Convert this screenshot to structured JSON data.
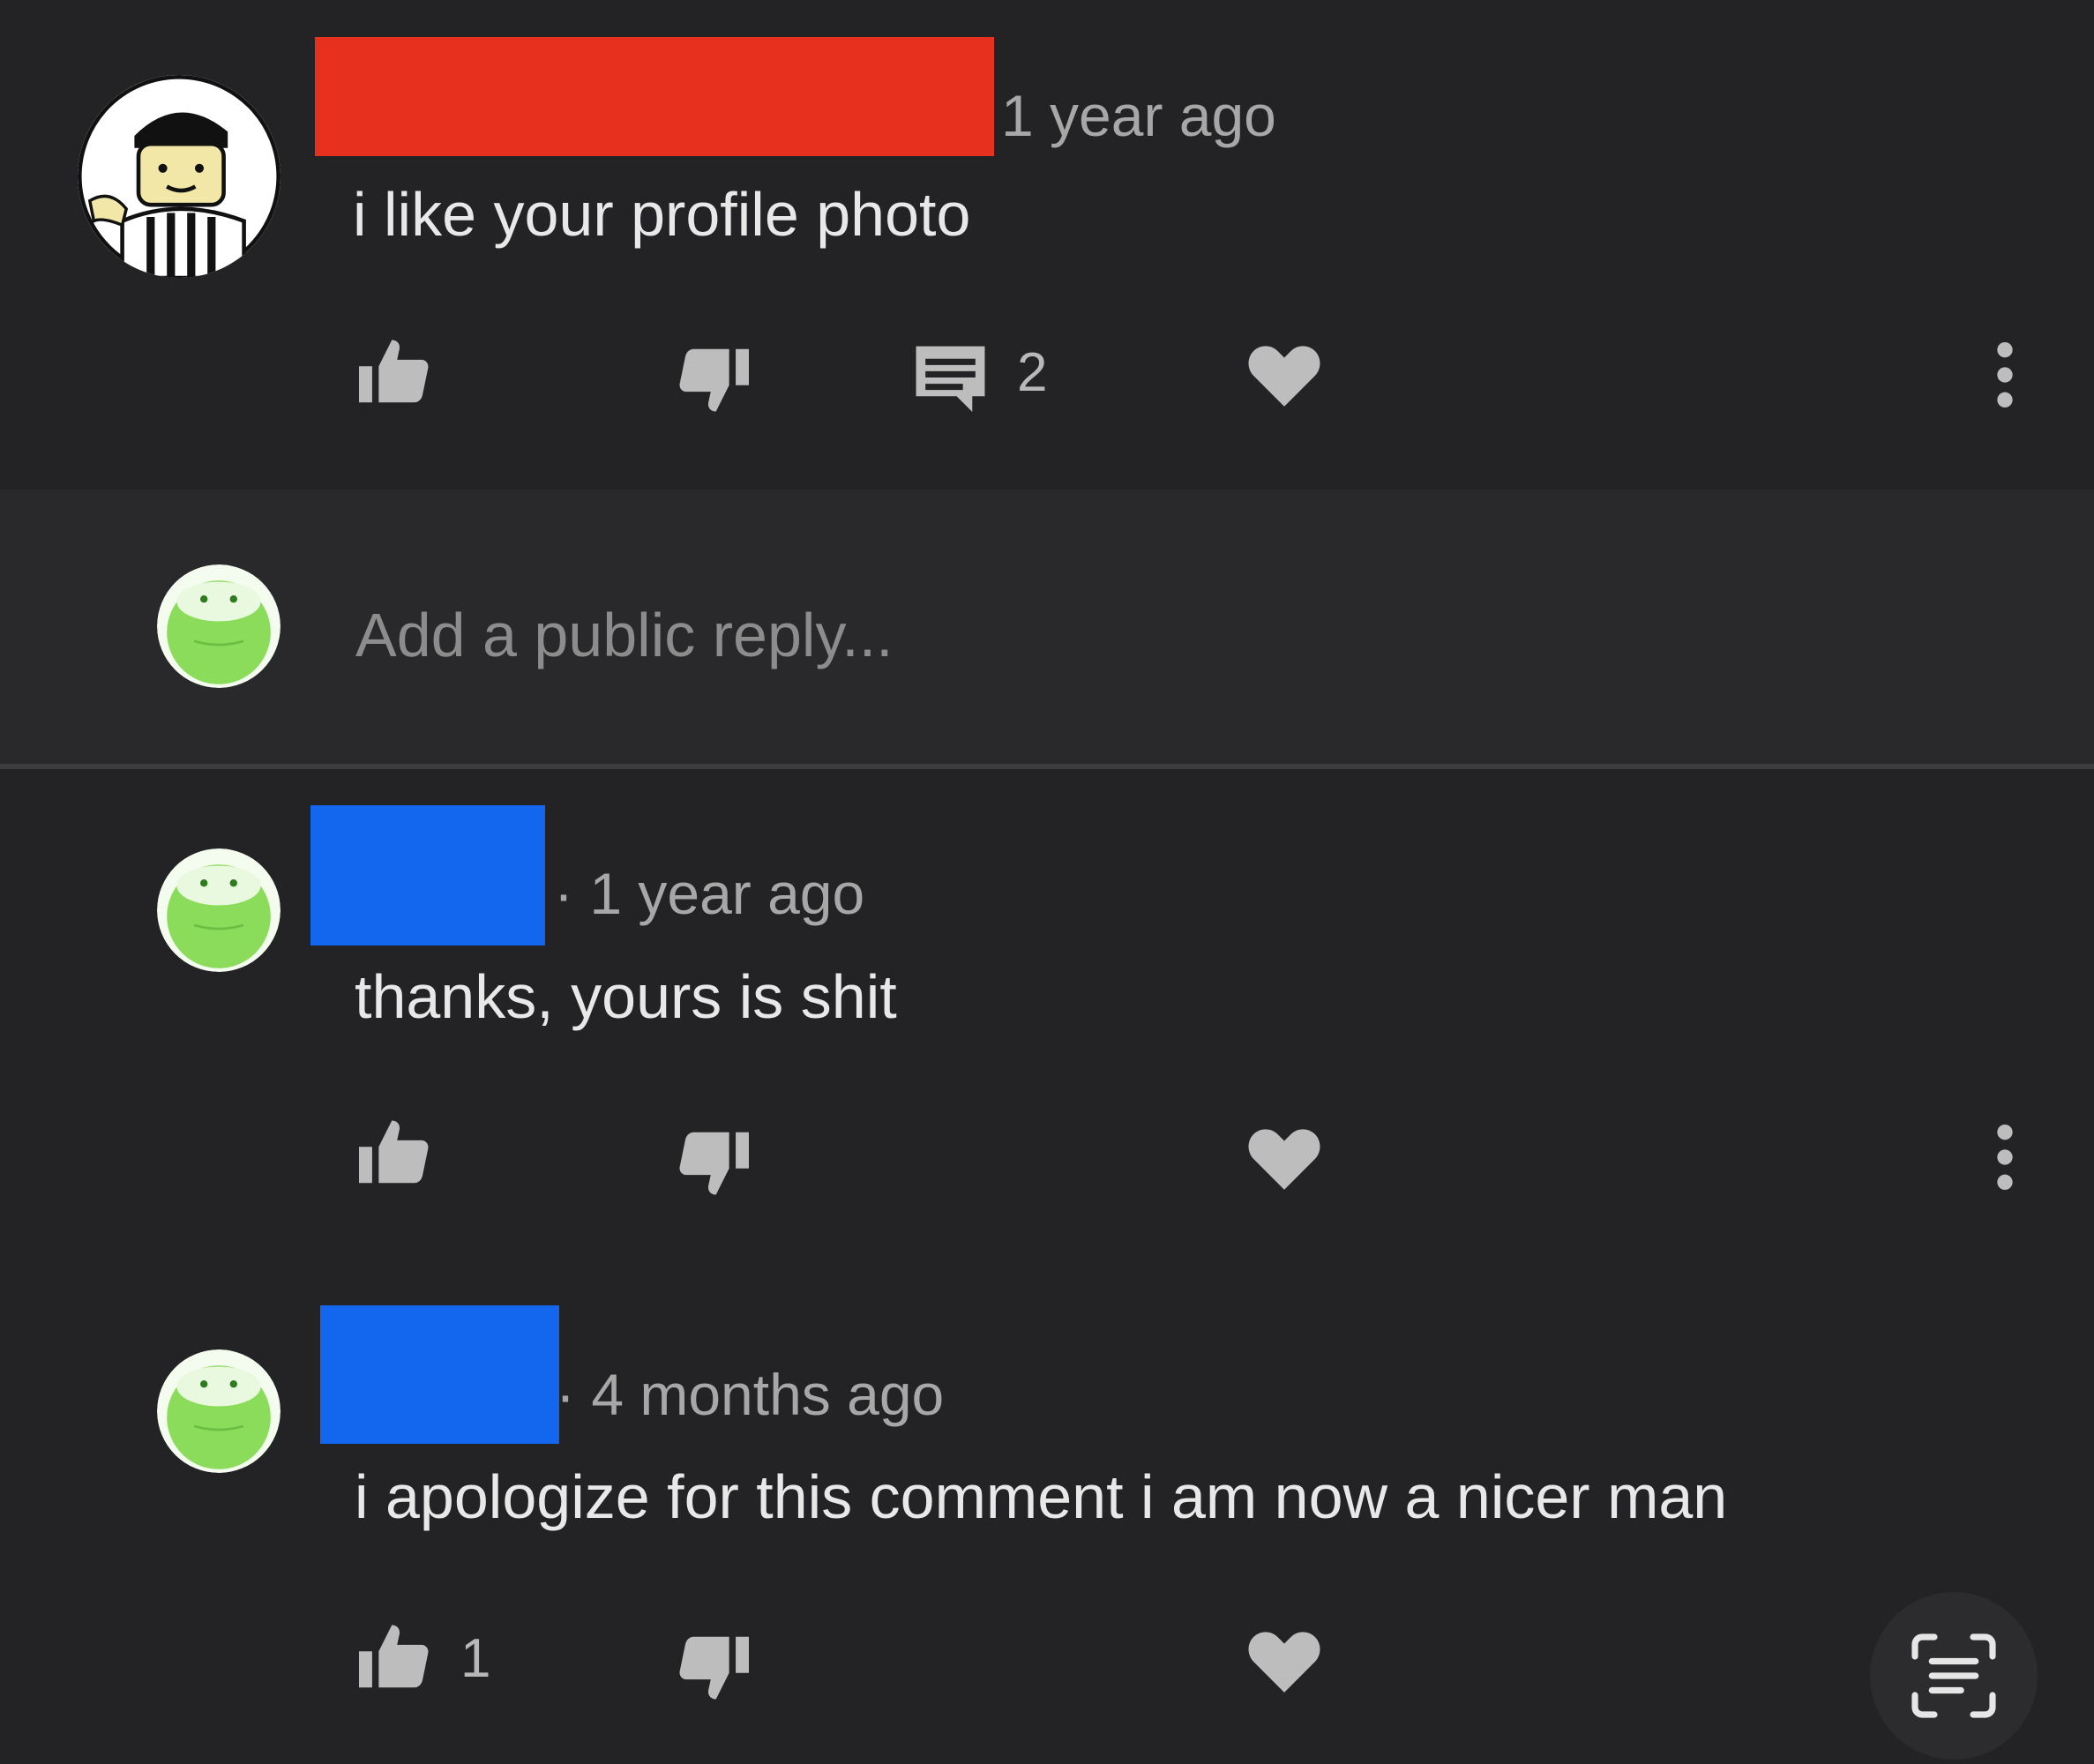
{
  "colors": {
    "background": "#232325",
    "reply_band": "#29292b",
    "redact_red": "#e8301f",
    "redact_blue": "#1267ee",
    "avatar_green": "#8bdc5b"
  },
  "comments": [
    {
      "timestamp": "1 year ago",
      "text": "i like your profile photo",
      "reply_count": "2",
      "like_count": ""
    },
    {
      "timestamp": "· 1 year ago",
      "text": "thanks, yours is shit",
      "like_count": ""
    },
    {
      "timestamp": "· 4 months ago",
      "text": "i apologize for this comment i am now a nicer man",
      "like_count": "1"
    }
  ],
  "reply_box": {
    "placeholder": "Add a public reply..."
  },
  "icons": {
    "like": "thumbs-up-icon",
    "dislike": "thumbs-down-icon",
    "reply": "comment-icon",
    "heart": "heart-icon",
    "more": "more-vertical-icon",
    "scan": "text-scan-icon"
  }
}
